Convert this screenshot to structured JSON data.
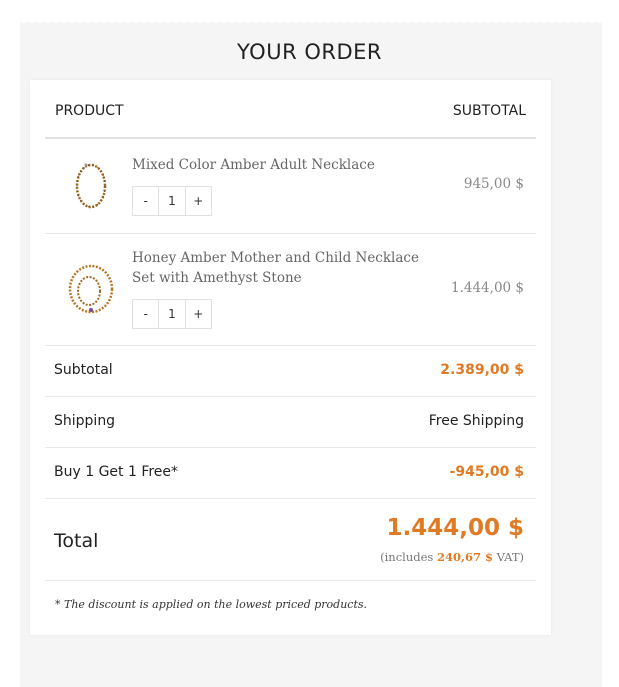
{
  "order": {
    "title": "YOUR ORDER",
    "headers": {
      "product": "PRODUCT",
      "subtotal": "SUBTOTAL"
    },
    "items": [
      {
        "name": "Mixed Color Amber Adult Necklace",
        "qty": "1",
        "minus": "-",
        "plus": "+",
        "price": "945,00 $",
        "icon": "amber-necklace-image"
      },
      {
        "name": "Honey Amber Mother and Child Necklace Set with Amethyst Stone",
        "qty": "1",
        "minus": "-",
        "plus": "+",
        "price": "1.444,00 $",
        "icon": "amber-necklace-set-image"
      }
    ],
    "subtotal": {
      "label": "Subtotal",
      "value": "2.389,00 $"
    },
    "shipping": {
      "label": "Shipping",
      "value": "Free Shipping"
    },
    "discount": {
      "label": "Buy 1 Get 1 Free*",
      "value": "-945,00 $"
    },
    "total": {
      "label": "Total",
      "value": "1.444,00 $",
      "vat_prefix": "(includes",
      "vat_amount": "240,67 $",
      "vat_suffix": "VAT)"
    },
    "note": "* The discount is applied on the lowest priced products."
  },
  "colors": {
    "accent": "#e07a24",
    "background": "#f5f5f5",
    "card": "#ffffff"
  }
}
